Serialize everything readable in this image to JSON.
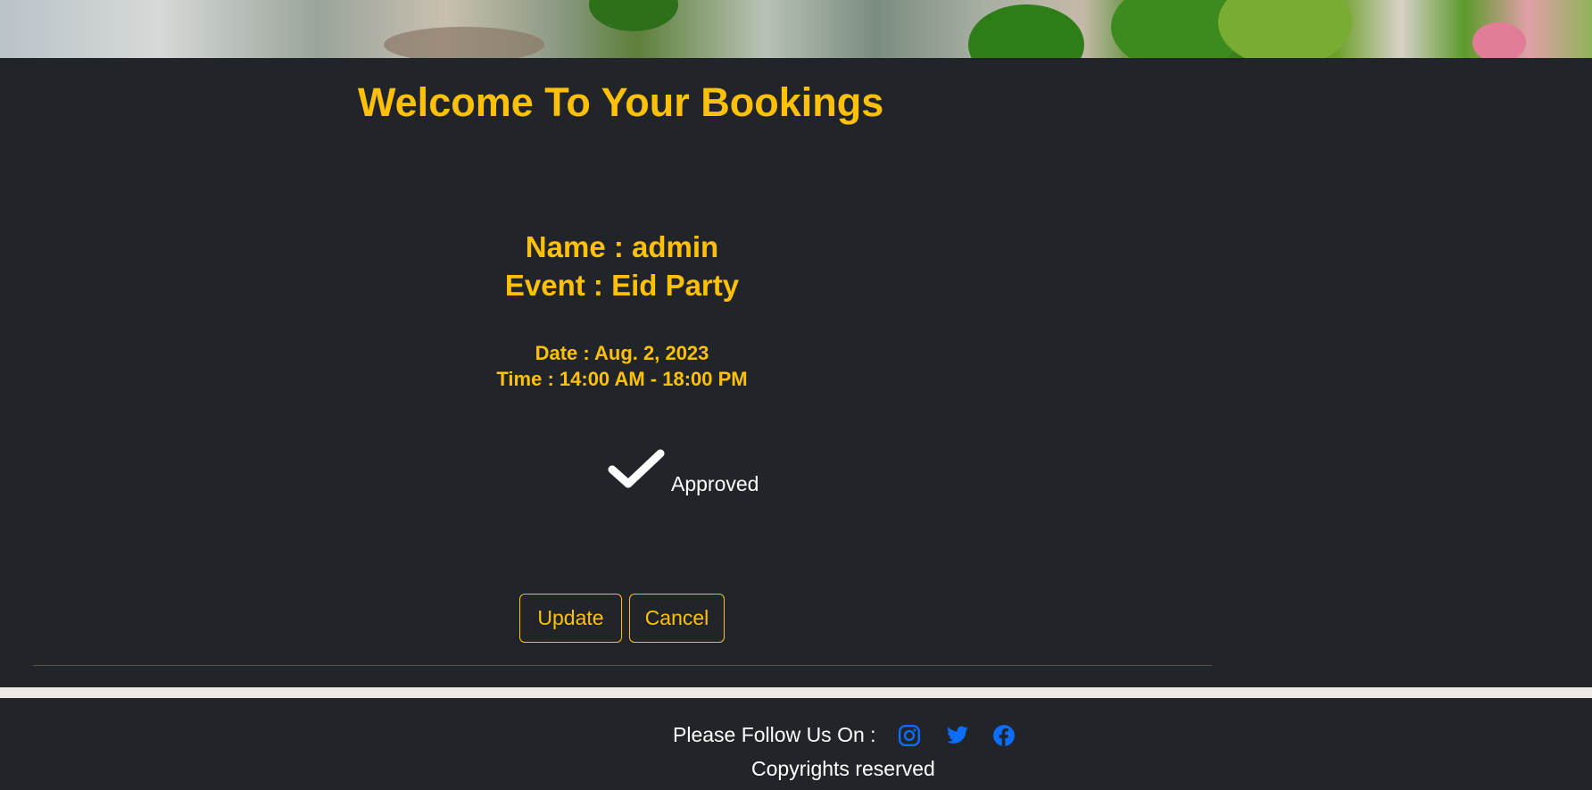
{
  "page": {
    "title": "Welcome To Your Bookings"
  },
  "booking": {
    "name_line": "Name : admin",
    "event_line": "Event : Eid Party",
    "date_line": "Date : Aug. 2, 2023",
    "time_line": "Time : 14:00 AM - 18:00 PM",
    "status": "Approved",
    "status_icon": "checkmark-icon"
  },
  "actions": {
    "update_label": "Update",
    "cancel_label": "Cancel"
  },
  "footer": {
    "follow_label": "Please Follow Us On :",
    "social_icons": [
      "instagram-icon",
      "twitter-icon",
      "facebook-icon"
    ],
    "copyright": "Copyrights reserved"
  },
  "colors": {
    "background": "#212529",
    "accent": "#ffc107",
    "social": "#0d6efd",
    "text": "#ffffff"
  }
}
